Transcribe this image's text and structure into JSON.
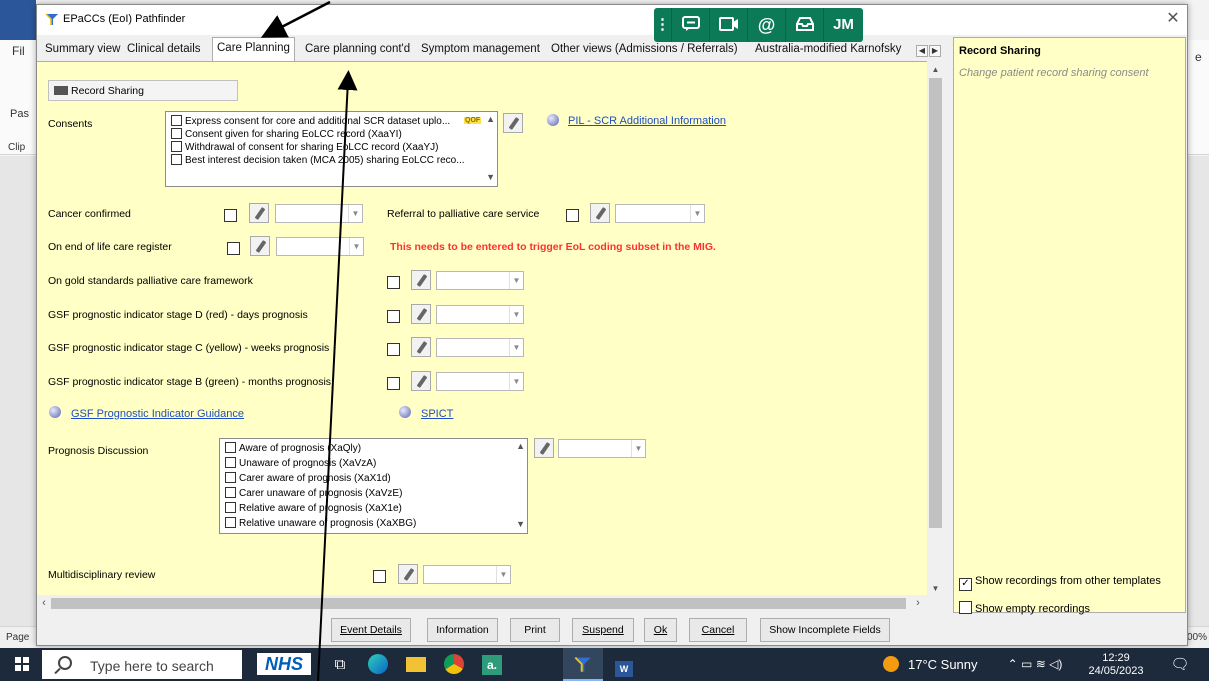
{
  "word_window": {
    "tab_initials": "A",
    "file_tab_partial": "Fil",
    "paste_partial": "Pas",
    "clipboard_partial": "Clip",
    "page_partial": "Page",
    "zoom_partial": "00%",
    "right_partial": "e"
  },
  "dialog": {
    "title": "EPaCCs (EoI) Pathfinder",
    "close_glyph": "✕"
  },
  "tabs": [
    {
      "label": "Summary view"
    },
    {
      "label": "Clinical details"
    },
    {
      "label": "Care Planning"
    },
    {
      "label": "Care planning cont'd"
    },
    {
      "label": "Symptom management"
    },
    {
      "label": "Other views (Admissions / Referrals)"
    },
    {
      "label": "Australia-modified Karnofsky"
    }
  ],
  "content": {
    "record_sharing_button": "Record Sharing",
    "consents": {
      "label": "Consents",
      "qof_badge": "QOF",
      "items": [
        "Express consent for core and additional SCR dataset uplo...",
        "Consent given for sharing EoLCC record (XaaYI)",
        "Withdrawal of consent for sharing EoLCC record (XaaYJ)",
        "Best interest decision taken (MCA 2005) sharing EoLCC reco..."
      ],
      "link": "PIL - SCR Additional Information"
    },
    "cancer_confirmed": "Cancer confirmed",
    "referral_palliative": "Referral to palliative care service",
    "eol_register": "On end of life care register",
    "eol_warning": "This needs to be entered to trigger EoL coding subset in the MIG.",
    "gold_standards": "On gold standards palliative care framework",
    "gsf_d": "GSF prognostic indicator stage D (red) - days prognosis",
    "gsf_c": "GSF prognostic indicator stage C (yellow) - weeks prognosis",
    "gsf_b": "GSF prognostic indicator stage B (green) - months prognosis",
    "gsf_link": "GSF Prognostic Indicator Guidance",
    "spict_link": "SPICT",
    "prognosis": {
      "label": "Prognosis Discussion",
      "items": [
        "Aware of prognosis (XaQly)",
        "Unaware of prognosis (XaVzA)",
        "Carer aware of prognosis (XaX1d)",
        "Carer unaware of prognosis (XaVzE)",
        "Relative aware of prognosis (XaX1e)",
        "Relative unaware of prognosis (XaXBG)"
      ]
    },
    "mdt_review": "Multidisciplinary review"
  },
  "right_panel": {
    "title": "Record Sharing",
    "subtitle": "Change patient record sharing consent",
    "show_other_templates": "Show recordings from other templates",
    "show_other_templates_checked": true,
    "show_empty": "Show empty recordings",
    "show_empty_checked": false
  },
  "buttons": {
    "event_details": "Event Details",
    "information": "Information",
    "print": "Print",
    "suspend": "Suspend",
    "ok": "Ok",
    "cancel": "Cancel",
    "show_incomplete": "Show Incomplete Fields"
  },
  "floating_toolbar": {
    "initials": "JM",
    "at_glyph": "@"
  },
  "taskbar": {
    "search_placeholder": "Type here to search",
    "nhs": "NHS",
    "a_label": "a.",
    "word_label": "W",
    "weather": "17°C  Sunny",
    "time": "12:29",
    "date": "24/05/2023"
  },
  "colors": {
    "form_bg": "#ffffc6",
    "warning": "#ff3030",
    "link": "#1f4fbf",
    "toolbar_green": "#0d7a57",
    "taskbar": "#1c2a3c"
  }
}
